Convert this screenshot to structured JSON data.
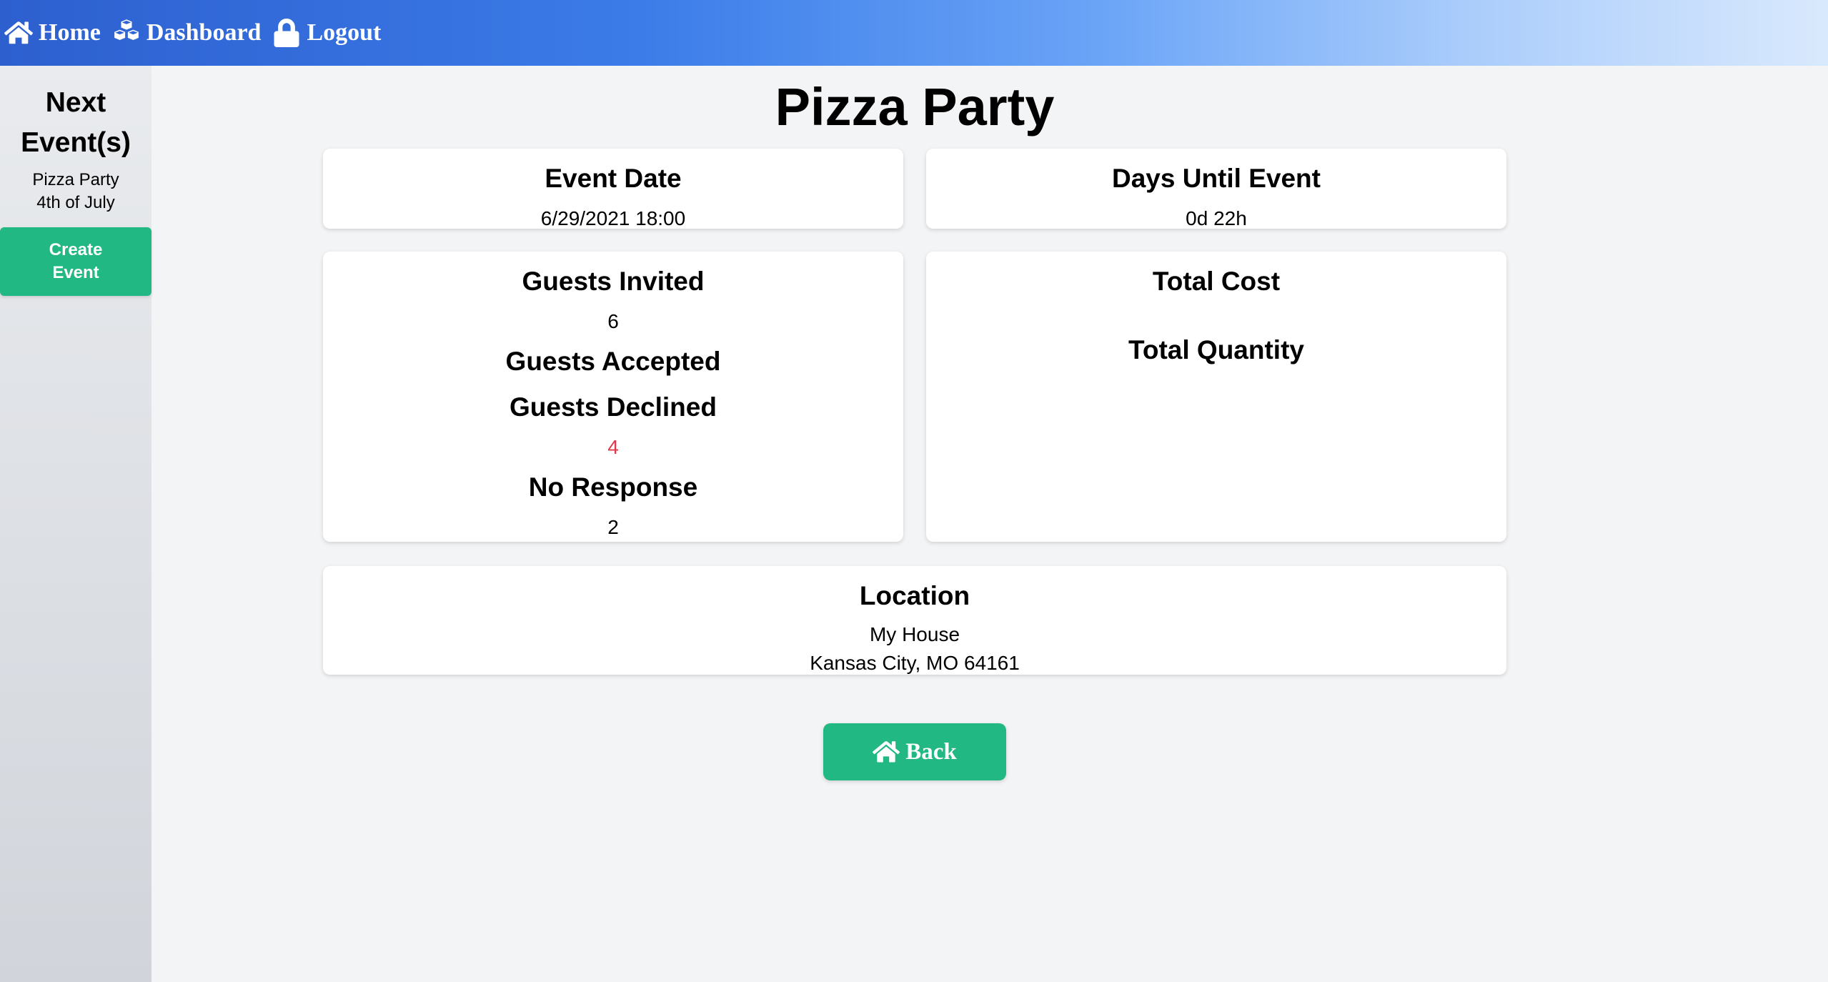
{
  "nav": {
    "home_label": "Home",
    "home_icon": "home-icon",
    "dashboard_label": "Dashboard",
    "dashboard_icon": "cubes-icon",
    "logout_label": "Logout",
    "logout_icon": "lock-icon"
  },
  "sidebar": {
    "title": "Next Event(s)",
    "events": [
      "Pizza Party",
      "4th of July"
    ],
    "create_button_label": "Create Event"
  },
  "event": {
    "title": "Pizza Party",
    "date_heading": "Event Date",
    "date_value": "6/29/2021 18:00",
    "days_heading": "Days Until Event",
    "days_value": "0d 22h",
    "invited_heading": "Guests Invited",
    "invited_value": "6",
    "accepted_heading": "Guests Accepted",
    "declined_heading": "Guests Declined",
    "declined_value": "4",
    "no_response_heading": "No Response",
    "no_response_value": "2",
    "total_cost_heading": "Total Cost",
    "total_quantity_heading": "Total Quantity",
    "location_heading": "Location",
    "location_name": "My House",
    "location_address": "Kansas City, MO 64161"
  },
  "back_button": {
    "label": "Back",
    "icon": "home-icon"
  },
  "colors": {
    "accent_green": "#22b883",
    "declined_red": "#e0394a",
    "nav_gradient_start": "#2d5fcf",
    "nav_gradient_end": "#d9e9fd"
  }
}
